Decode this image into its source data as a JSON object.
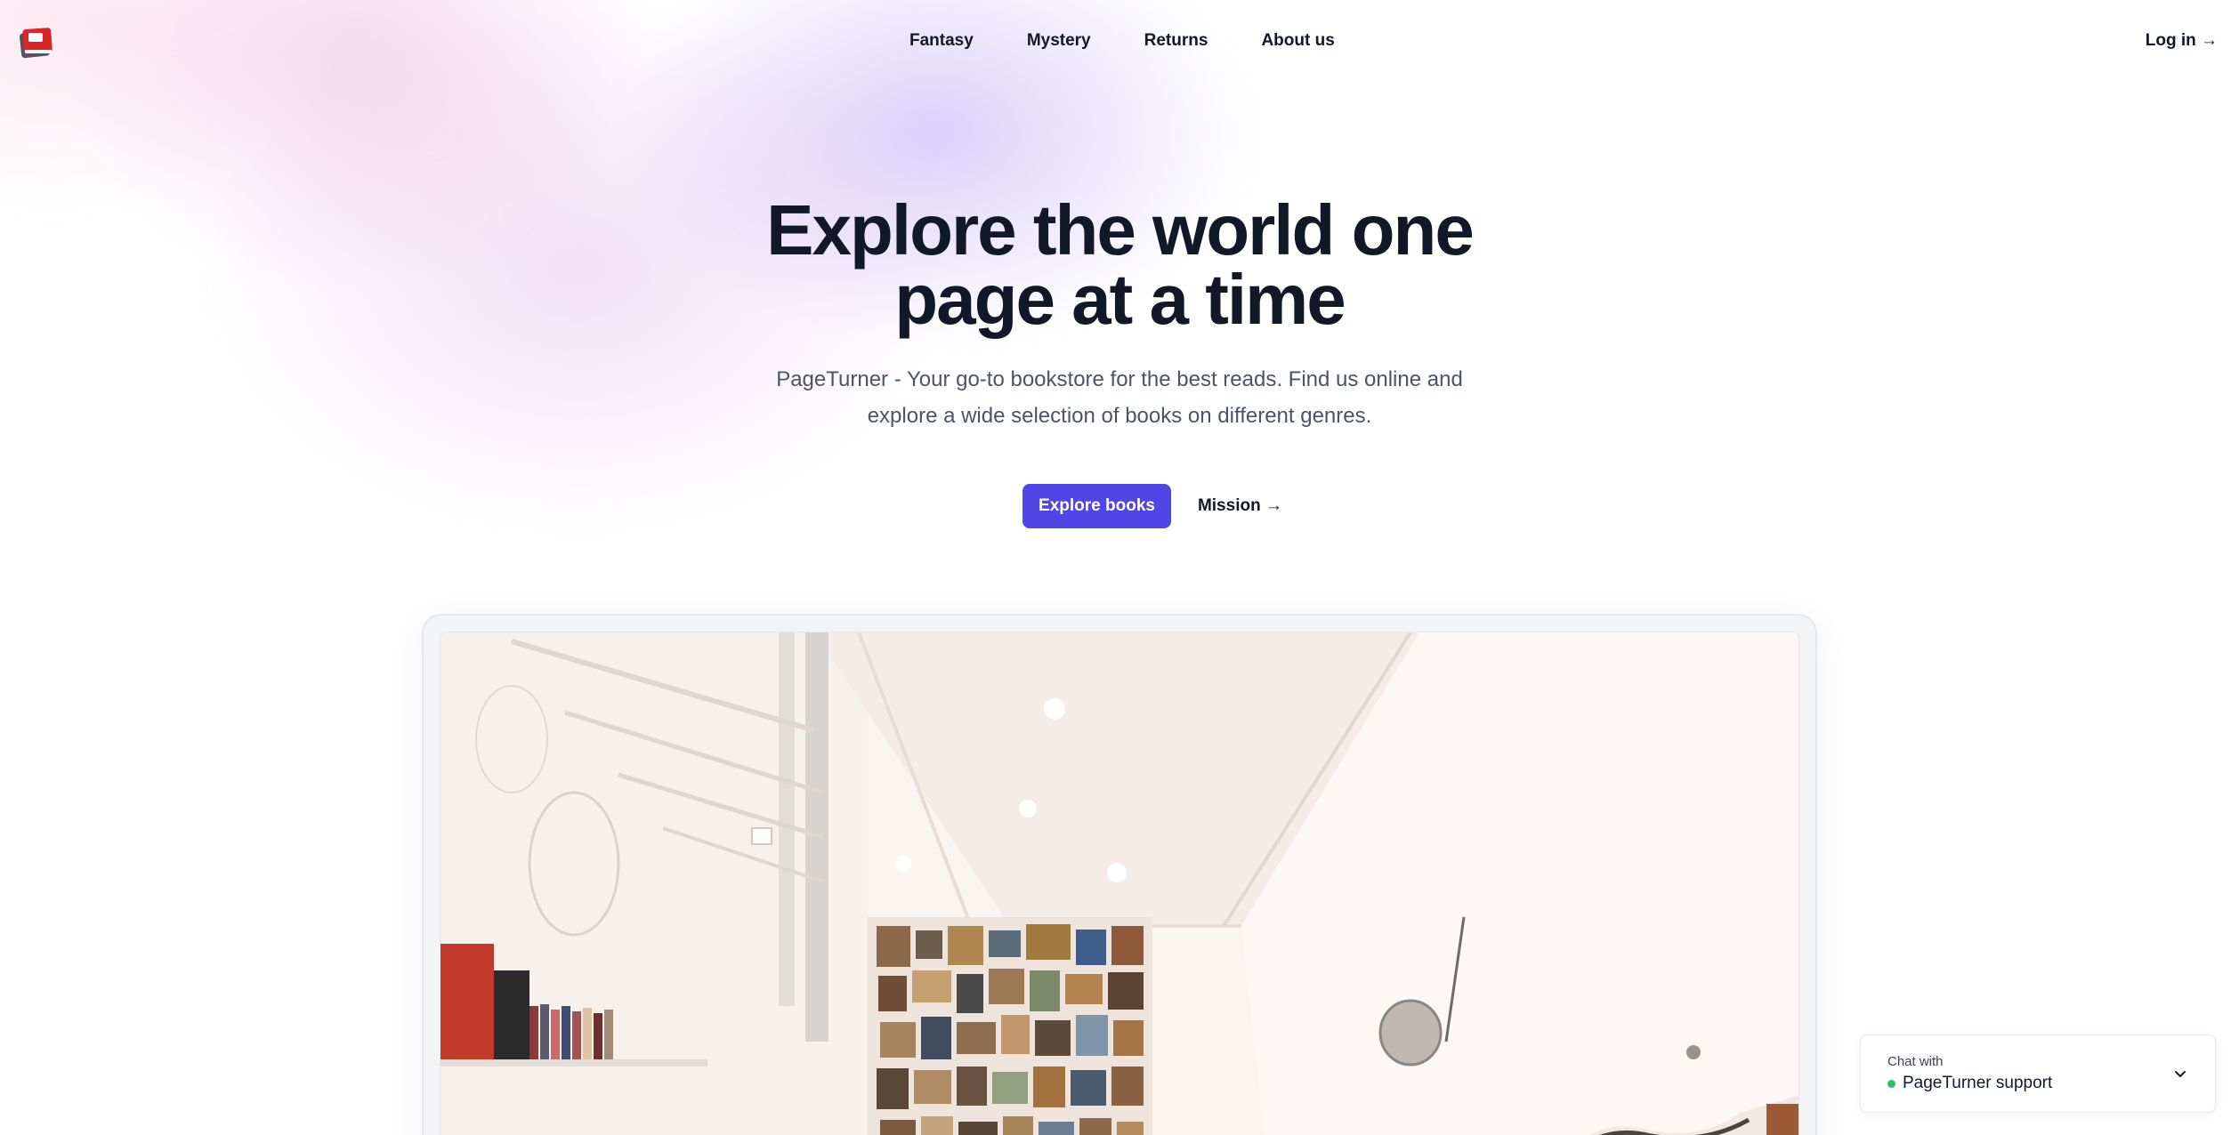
{
  "brand": {
    "logo": "book-stack-logo-icon",
    "accent": "#4f46e5",
    "status_online": "#22c55e"
  },
  "nav": {
    "items": [
      {
        "label": "Fantasy"
      },
      {
        "label": "Mystery"
      },
      {
        "label": "Returns"
      },
      {
        "label": "About us"
      }
    ],
    "login_label": "Log in →"
  },
  "hero": {
    "title_line1": "Explore the world one",
    "title_line2": "page at a time",
    "subtitle": "PageTurner - Your go-to bookstore for the best reads. Find us online and explore a wide selection of books on different genres.",
    "primary_cta": "Explore books",
    "secondary_cta": "Mission →"
  },
  "chat": {
    "small_label": "Chat with",
    "name": "PageTurner support",
    "chevron": "chevron-down-icon"
  }
}
